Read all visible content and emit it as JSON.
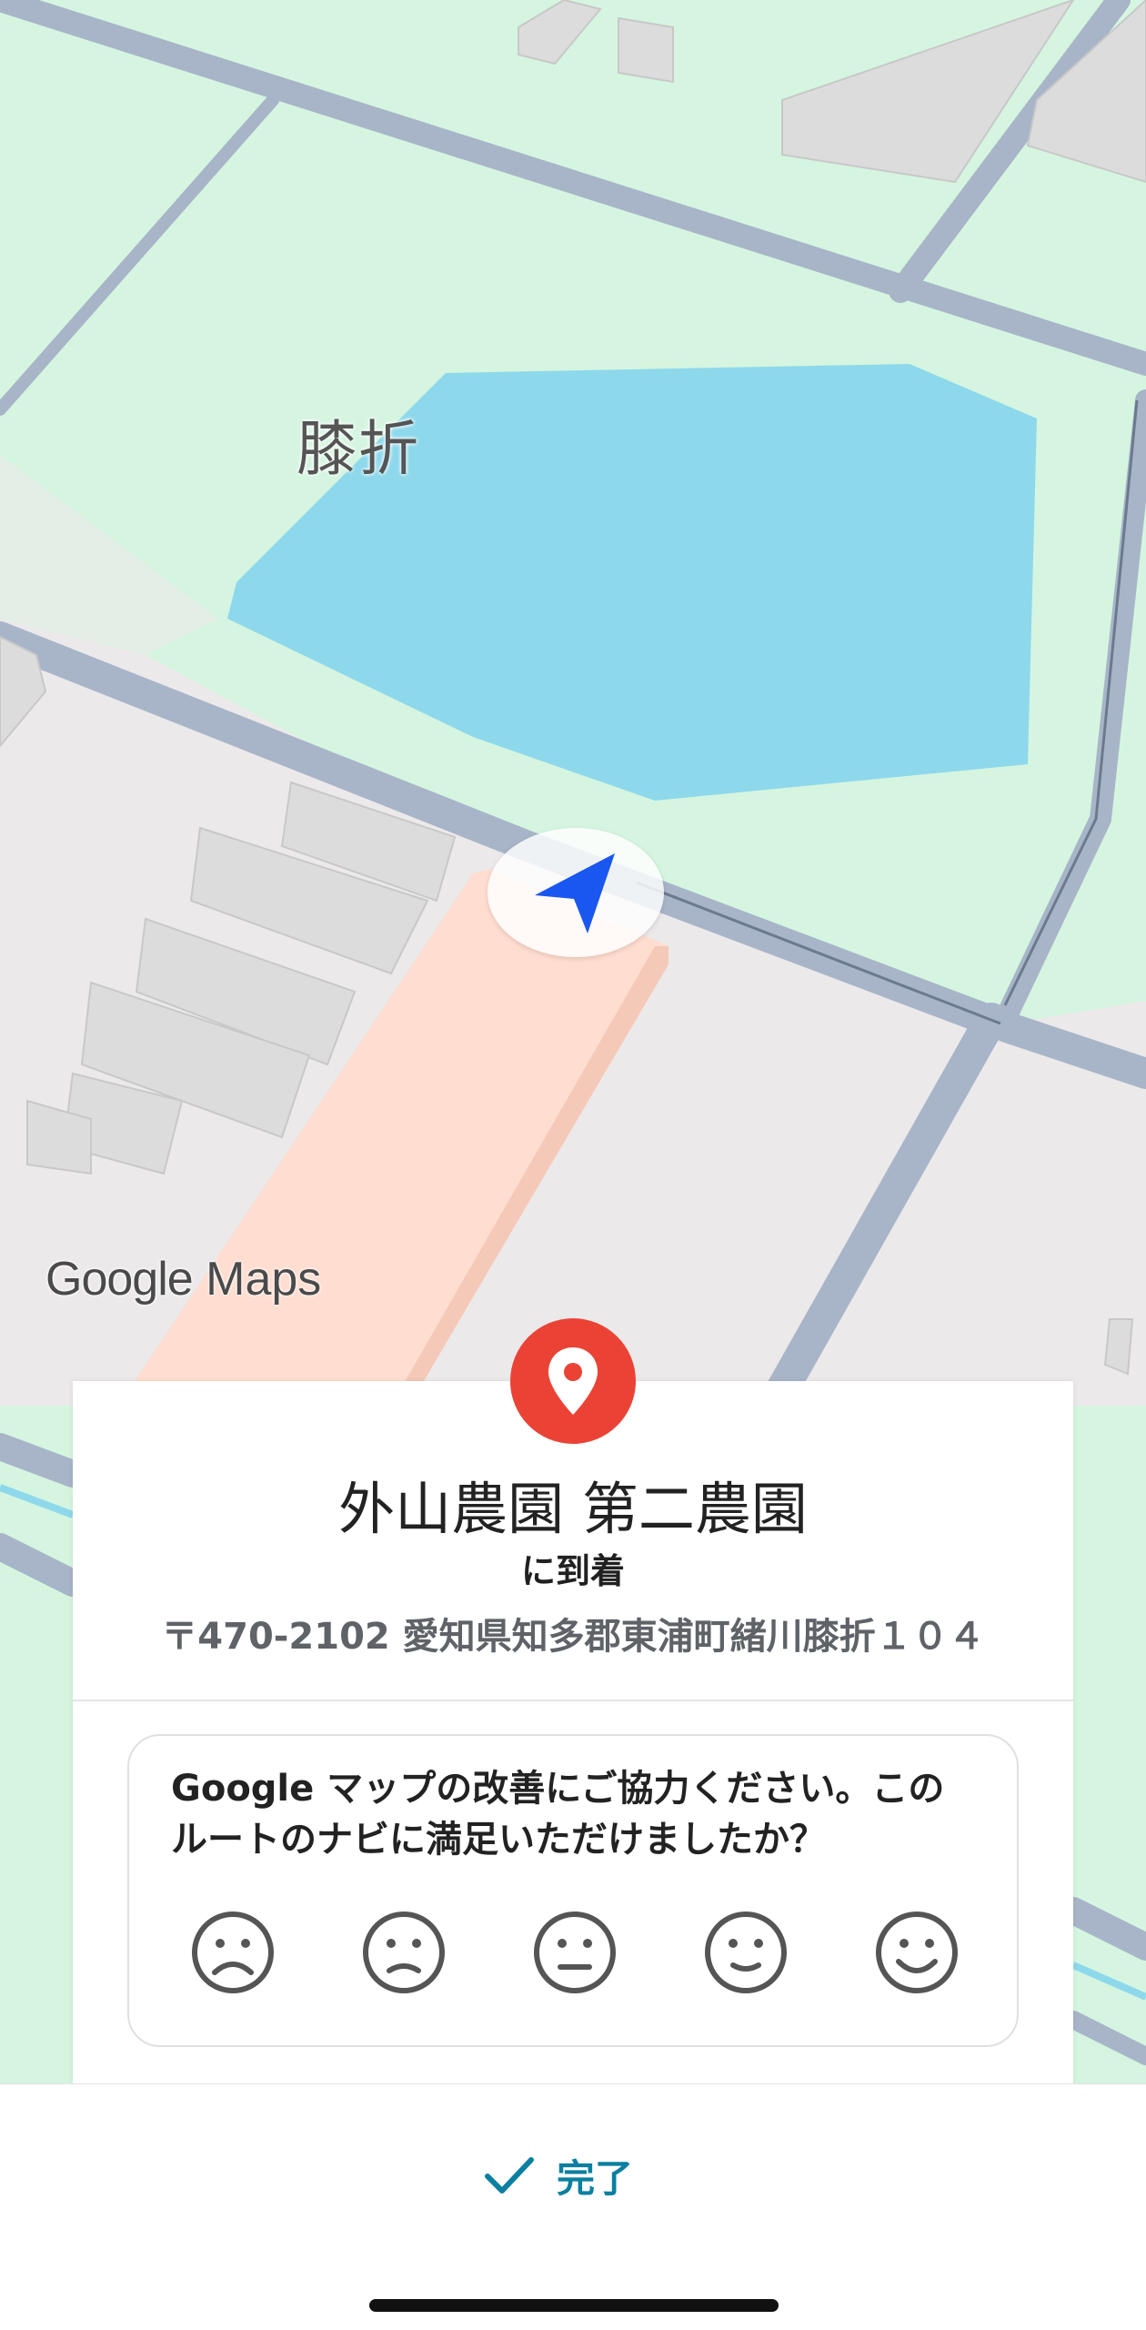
{
  "map": {
    "place_label": "膝折",
    "logo": {
      "google": "Google",
      "maps": "Maps"
    },
    "colors": {
      "land": "#d5f5e0",
      "water": "#8ed8ec",
      "road": "#a8b5c8",
      "building_area": "#ece9ea",
      "highlight": "#ffddd0",
      "nav_arrow": "#1a56f0"
    },
    "icons": {
      "navigation": "navigation-arrow-icon"
    }
  },
  "card": {
    "destination_name": "外山農園 第二農園",
    "arrived_text": "に到着",
    "address": "〒470-2102 愛知県知多郡東浦町緒川膝折１０４",
    "pin_icon": "location-pin-icon",
    "pin_color": "#ea4335",
    "feedback": {
      "question": "Google マップの改善にご協力ください。このルートのナビに満足いただけましたか？",
      "options": [
        {
          "icon": "very-dissatisfied-face-icon"
        },
        {
          "icon": "dissatisfied-face-icon"
        },
        {
          "icon": "neutral-face-icon"
        },
        {
          "icon": "satisfied-face-icon"
        },
        {
          "icon": "very-satisfied-face-icon"
        }
      ]
    }
  },
  "bottom_bar": {
    "done_label": "完了",
    "done_icon": "checkmark-icon",
    "accent_color": "#0b7fa0"
  }
}
